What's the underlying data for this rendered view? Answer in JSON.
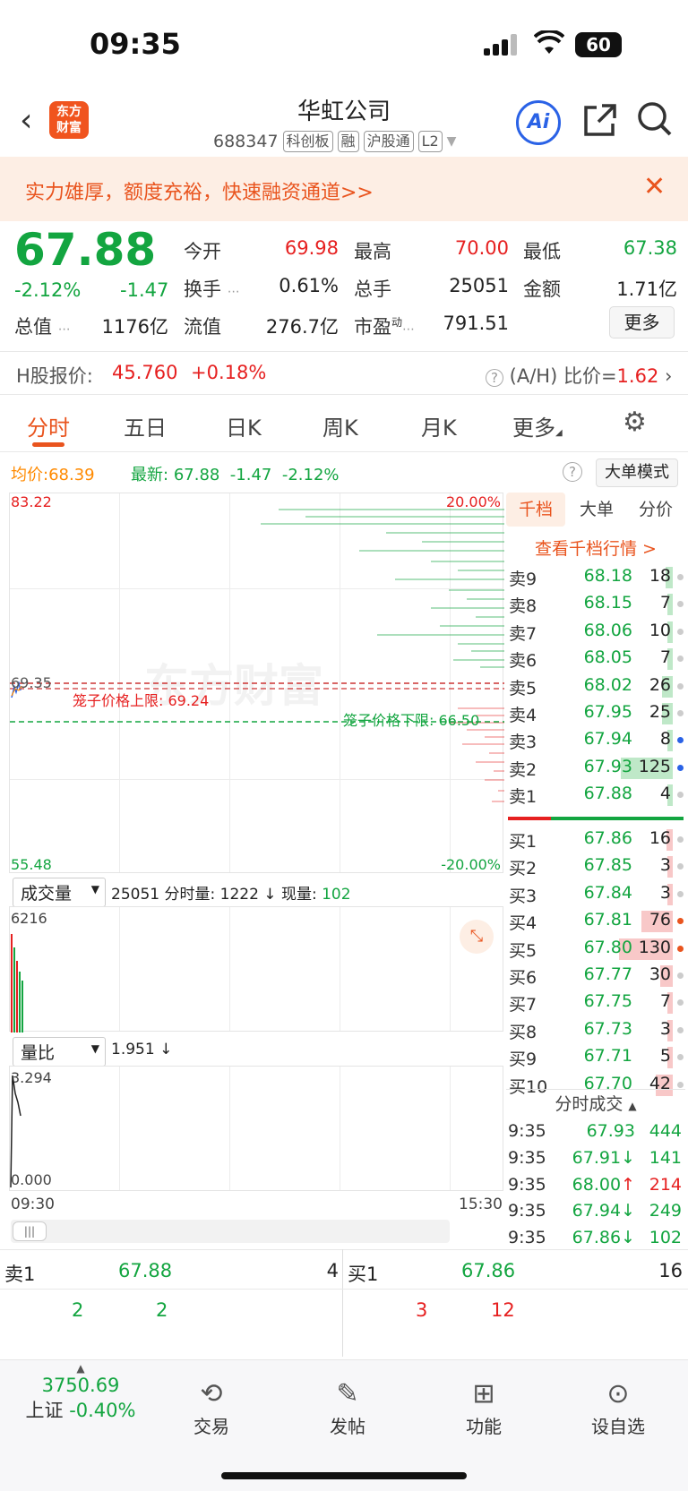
{
  "status": {
    "time": "09:35",
    "battery": "60"
  },
  "header": {
    "back": "‹",
    "logo_line1": "东方",
    "logo_line2": "财富",
    "name": "华虹公司",
    "code": "688347",
    "tags": [
      "科创板",
      "融",
      "沪股通",
      "L2"
    ],
    "ai_label": "Ai"
  },
  "banner": {
    "text": "实力雄厚，额度充裕，快速融资通道>>"
  },
  "quote": {
    "price": "67.88",
    "pct": "-2.12%",
    "chg": "-1.47",
    "open_label": "今开",
    "open": "69.98",
    "high_label": "最高",
    "high": "70.00",
    "low_label": "最低",
    "low": "67.38",
    "turnover_label": "换手",
    "turnover": "0.61%",
    "vol_label": "总手",
    "vol": "25051",
    "amount_label": "金额",
    "amount": "1.71亿",
    "mcap_label": "总值",
    "mcap": "1176亿",
    "float_label": "流值",
    "float": "276.7亿",
    "pe_label": "市盈",
    "pe_sup": "动",
    "pe": "791.51",
    "more": "更多"
  },
  "hshare": {
    "label": "H股报价:",
    "price": "45.760",
    "pct": "+0.18%",
    "ratio_label": "(A/H) 比价=",
    "ratio": "1.62"
  },
  "tabs": [
    "分时",
    "五日",
    "日K",
    "周K",
    "月K",
    "更多"
  ],
  "chart_head": {
    "avg_label": "均价:",
    "avg": "68.39",
    "last_label": "最新:",
    "last": "67.88",
    "chg": "-1.47",
    "pct": "-2.12%",
    "mode": "大单模式"
  },
  "chart": {
    "top_price": "83.22",
    "mid_price": "69.35",
    "bottom_price": "55.48",
    "top_pct": "20.00%",
    "bottom_pct": "-20.00%",
    "cage_upper": "笼子价格上限: 69.24",
    "cage_lower": "笼子价格下限: 66.50",
    "watermark": "东方财富",
    "time_start": "09:30",
    "time_end": "15:30"
  },
  "volume": {
    "selector": "成交量",
    "info_total": "25051",
    "info_label1": "分时量:",
    "info_val1": "1222",
    "info_label2": "现量:",
    "info_val2": "102",
    "max": "6216"
  },
  "ratio": {
    "selector": "量比",
    "value": "1.951",
    "max": "3.294",
    "min": "0.000"
  },
  "book_tabs": [
    "千档",
    "大单",
    "分价"
  ],
  "book_link": "查看千档行情 >",
  "asks": [
    {
      "label": "卖9",
      "price": "68.18",
      "vol": "18"
    },
    {
      "label": "卖8",
      "price": "68.15",
      "vol": "7"
    },
    {
      "label": "卖7",
      "price": "68.06",
      "vol": "10"
    },
    {
      "label": "卖6",
      "price": "68.05",
      "vol": "7"
    },
    {
      "label": "卖5",
      "price": "68.02",
      "vol": "26"
    },
    {
      "label": "卖4",
      "price": "67.95",
      "vol": "25"
    },
    {
      "label": "卖3",
      "price": "67.94",
      "vol": "8"
    },
    {
      "label": "卖2",
      "price": "67.93",
      "vol": "125"
    },
    {
      "label": "卖1",
      "price": "67.88",
      "vol": "4"
    }
  ],
  "bids": [
    {
      "label": "买1",
      "price": "67.86",
      "vol": "16"
    },
    {
      "label": "买2",
      "price": "67.85",
      "vol": "3"
    },
    {
      "label": "买3",
      "price": "67.84",
      "vol": "3"
    },
    {
      "label": "买4",
      "price": "67.81",
      "vol": "76"
    },
    {
      "label": "买5",
      "price": "67.80",
      "vol": "130"
    },
    {
      "label": "买6",
      "price": "67.77",
      "vol": "30"
    },
    {
      "label": "买7",
      "price": "67.75",
      "vol": "7"
    },
    {
      "label": "买8",
      "price": "67.73",
      "vol": "3"
    },
    {
      "label": "买9",
      "price": "67.71",
      "vol": "5"
    },
    {
      "label": "买10",
      "price": "67.70",
      "vol": "42"
    }
  ],
  "trades_title": "分时成交",
  "trades": [
    {
      "time": "9:35",
      "price": "67.93",
      "dir": "",
      "vol": "444"
    },
    {
      "time": "9:35",
      "price": "67.91",
      "dir": "↓",
      "vol": "141"
    },
    {
      "time": "9:35",
      "price": "68.00",
      "dir": "↑",
      "vol": "214"
    },
    {
      "time": "9:35",
      "price": "67.94",
      "dir": "↓",
      "vol": "249"
    },
    {
      "time": "9:35",
      "price": "67.86",
      "dir": "↓",
      "vol": "102"
    }
  ],
  "bottom": {
    "ask_label": "卖1",
    "ask_price": "67.88",
    "ask_vol": "4",
    "bid_label": "买1",
    "bid_price": "67.86",
    "bid_vol": "16",
    "ask_q1": "2",
    "ask_q2": "2",
    "bid_q1": "3",
    "bid_q2": "12"
  },
  "nav": {
    "index_value": "3750.69",
    "index_name": "上证",
    "index_pct": "-0.40%",
    "trade": "交易",
    "post": "发帖",
    "func": "功能",
    "watch": "设自选"
  }
}
